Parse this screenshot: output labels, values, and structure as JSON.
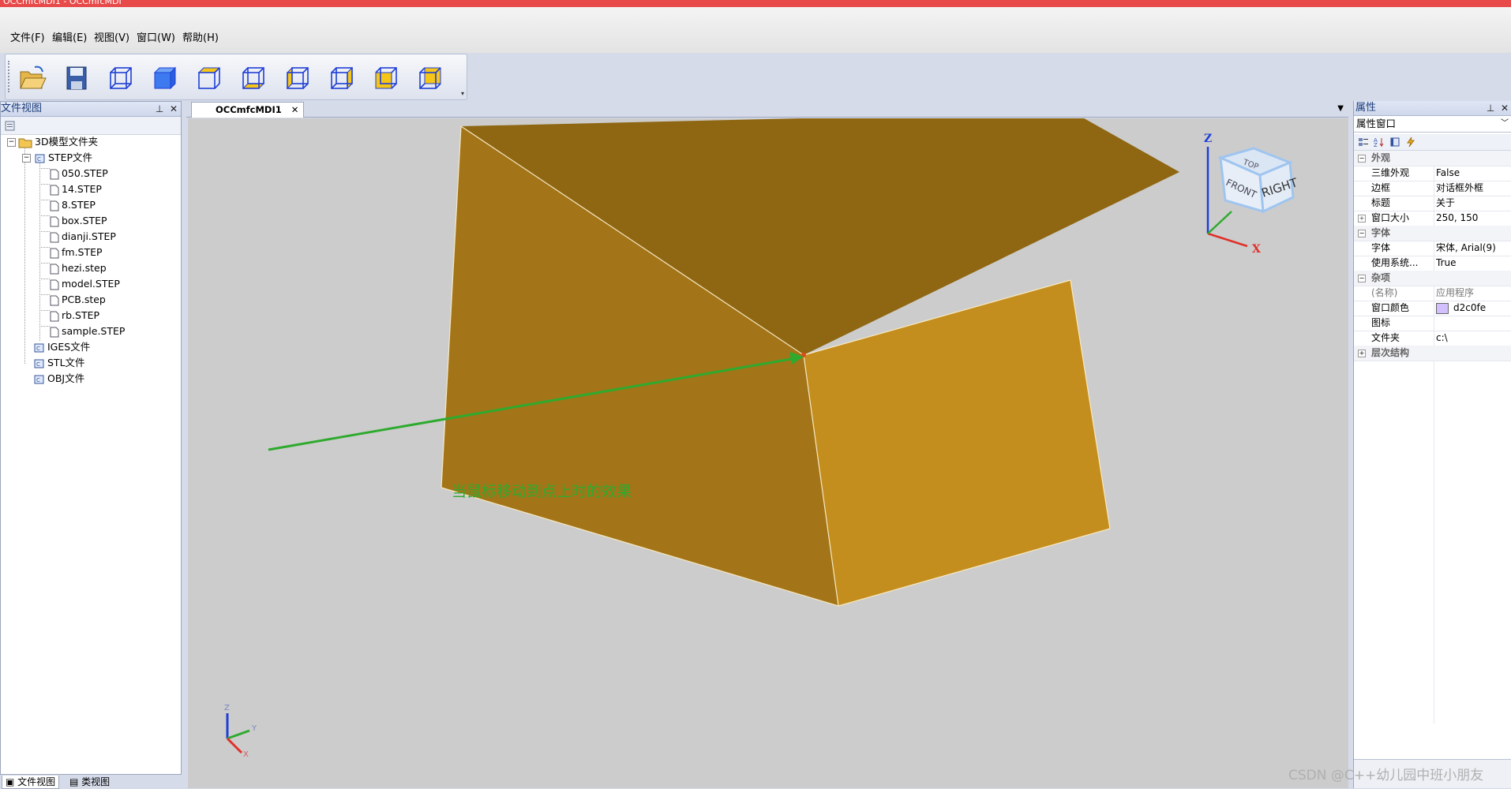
{
  "window": {
    "title": "OCCmfcMDI1 - OCCmfcMDI"
  },
  "menu": [
    {
      "label": "文件(F)"
    },
    {
      "label": "编辑(E)"
    },
    {
      "label": "视图(V)"
    },
    {
      "label": "窗口(W)"
    },
    {
      "label": "帮助(H)"
    }
  ],
  "toolbar": {
    "buttons": [
      {
        "icon": "open-folder-icon"
      },
      {
        "icon": "save-icon"
      },
      {
        "icon": "wireframe-cube-icon"
      },
      {
        "icon": "shaded-cube-icon"
      },
      {
        "icon": "top-view-icon"
      },
      {
        "icon": "bottom-view-icon"
      },
      {
        "icon": "left-view-icon"
      },
      {
        "icon": "right-view-icon"
      },
      {
        "icon": "front-view-icon"
      },
      {
        "icon": "back-view-icon"
      }
    ]
  },
  "file_view": {
    "title": "文件视图",
    "root": "3D模型文件夹",
    "groups": [
      {
        "label": "STEP文件",
        "files": [
          "050.STEP",
          "14.STEP",
          "8.STEP",
          "box.STEP",
          "dianji.STEP",
          "fm.STEP",
          "hezi.step",
          "model.STEP",
          "PCB.step",
          "rb.STEP",
          "sample.STEP"
        ]
      },
      {
        "label": "IGES文件"
      },
      {
        "label": "STL文件"
      },
      {
        "label": "OBJ文件"
      }
    ],
    "bottom_tabs": [
      "文件视图",
      "类视图"
    ]
  },
  "document": {
    "tab_label": "OCCmfcMDI1",
    "annotation": "当鼠标移动到点上时的效果",
    "viewcube": {
      "top": "TOP",
      "front": "FRONT",
      "right": "RIGHT"
    },
    "axis_labels": {
      "x": "X",
      "y": "Y",
      "z": "Z"
    },
    "colors": {
      "background": "#cccccc",
      "box_top": "#8f6611",
      "box_left": "#a37518",
      "box_right": "#c48e1f",
      "arrow": "#2eaa2e"
    }
  },
  "properties": {
    "title": "属性",
    "combo": "属性窗口",
    "rows": [
      {
        "type": "cat",
        "toggle": "−",
        "key": "外观"
      },
      {
        "type": "prop",
        "key": "三维外观",
        "value": "False"
      },
      {
        "type": "prop",
        "key": "边框",
        "value": "对话框外框"
      },
      {
        "type": "prop",
        "key": "标题",
        "value": "关于"
      },
      {
        "type": "prop",
        "toggle": "+",
        "key": "窗口大小",
        "value": "250, 150"
      },
      {
        "type": "cat",
        "toggle": "−",
        "key": "字体"
      },
      {
        "type": "prop",
        "key": "字体",
        "value": "宋体, Arial(9)"
      },
      {
        "type": "prop",
        "key": "使用系统...",
        "value": "True"
      },
      {
        "type": "cat",
        "toggle": "−",
        "key": "杂项"
      },
      {
        "type": "prop",
        "key": "(名称)",
        "value": "应用程序",
        "gray": true
      },
      {
        "type": "prop",
        "key": "窗口颜色",
        "value": "d2c0fe",
        "swatch": "#d2c0fe"
      },
      {
        "type": "prop",
        "key": "图标",
        "value": ""
      },
      {
        "type": "prop",
        "key": "文件夹",
        "value": "c:\\"
      },
      {
        "type": "cat",
        "toggle": "+",
        "key": "层次结构"
      }
    ]
  },
  "watermark": "CSDN @C++幼儿园中班小朋友"
}
